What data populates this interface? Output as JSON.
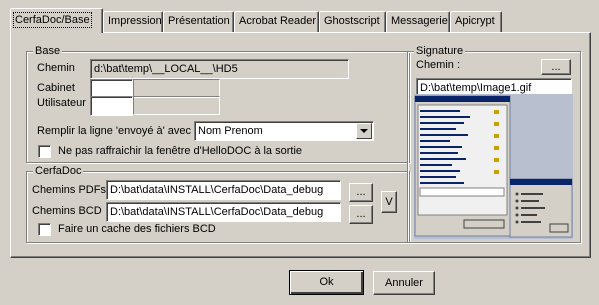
{
  "tabs": [
    {
      "label": "CerfaDoc/Base",
      "active": true
    },
    {
      "label": "Impression"
    },
    {
      "label": "Présentation"
    },
    {
      "label": "Acrobat Reader"
    },
    {
      "label": "Ghostscript"
    },
    {
      "label": "Messagerie"
    },
    {
      "label": "Apicrypt"
    }
  ],
  "base": {
    "legend": "Base",
    "chemin_label": "Chemin",
    "chemin_value": "d:\\bat\\temp\\__LOCAL__\\HD5",
    "cabinet_label": "Cabinet",
    "utilisateur_label": "Utilisateur",
    "remplir_label": "Remplir la ligne 'envoyé à' avec",
    "remplir_value": "Nom Prenom",
    "no_refresh_label": "Ne pas raffraichir la fenêtre d'HelloDOC à la sortie",
    "no_refresh_checked": false
  },
  "cerfadoc": {
    "legend": "CerfaDoc",
    "pdfs_label": "Chemins PDFs",
    "pdfs_value": "D:\\bat\\data\\INSTALL\\CerfaDoc\\Data_debug",
    "bcd_label": "Chemins BCD",
    "bcd_value": "D:\\bat\\data\\INSTALL\\CerfaDoc\\Data_debug",
    "browse_label": "...",
    "v_label": "V",
    "cache_label": "Faire un cache des fichiers BCD",
    "cache_checked": false
  },
  "signature": {
    "legend": "Signature",
    "chemin_label": "Chemin :",
    "chemin_value": "D:\\bat\\temp\\Image1.gif",
    "browse_label": "..."
  },
  "footer": {
    "ok_label": "Ok",
    "cancel_label": "Annuler"
  },
  "colors": {
    "face": "#d4d0c8",
    "titlebar": "#0a246a"
  }
}
